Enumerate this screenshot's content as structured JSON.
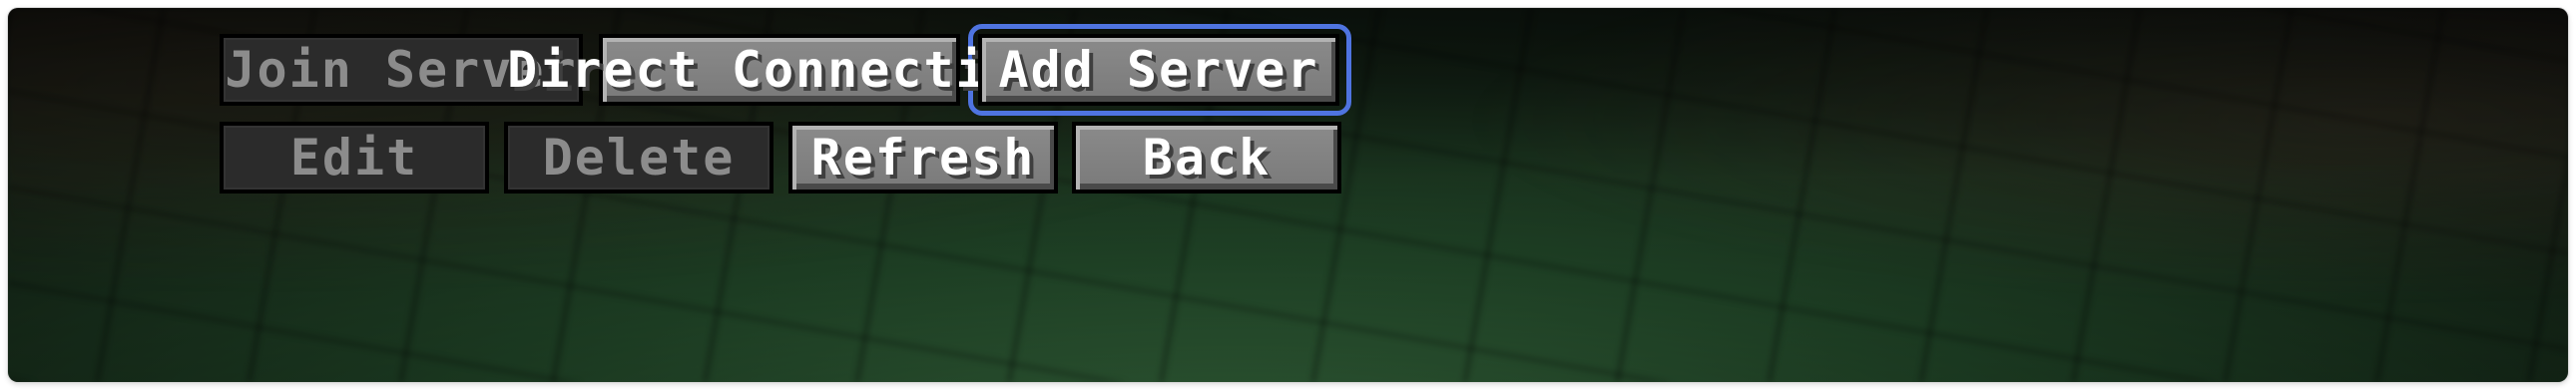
{
  "menu": {
    "buttons": [
      {
        "label": "Join Server",
        "enabled": false
      },
      {
        "label": "Direct Connection",
        "enabled": true
      },
      {
        "label": "Add Server",
        "enabled": true,
        "focused": true
      },
      {
        "label": "Edit",
        "enabled": false
      },
      {
        "label": "Delete",
        "enabled": false
      },
      {
        "label": "Refresh",
        "enabled": true
      },
      {
        "label": "Back",
        "enabled": true
      }
    ]
  },
  "colors": {
    "focus_ring": "#4f74e0",
    "button_enabled": "#7f7f7f",
    "button_disabled": "#2b2b2b",
    "text_enabled": "#ffffff",
    "text_disabled": "#8c8c8c"
  }
}
